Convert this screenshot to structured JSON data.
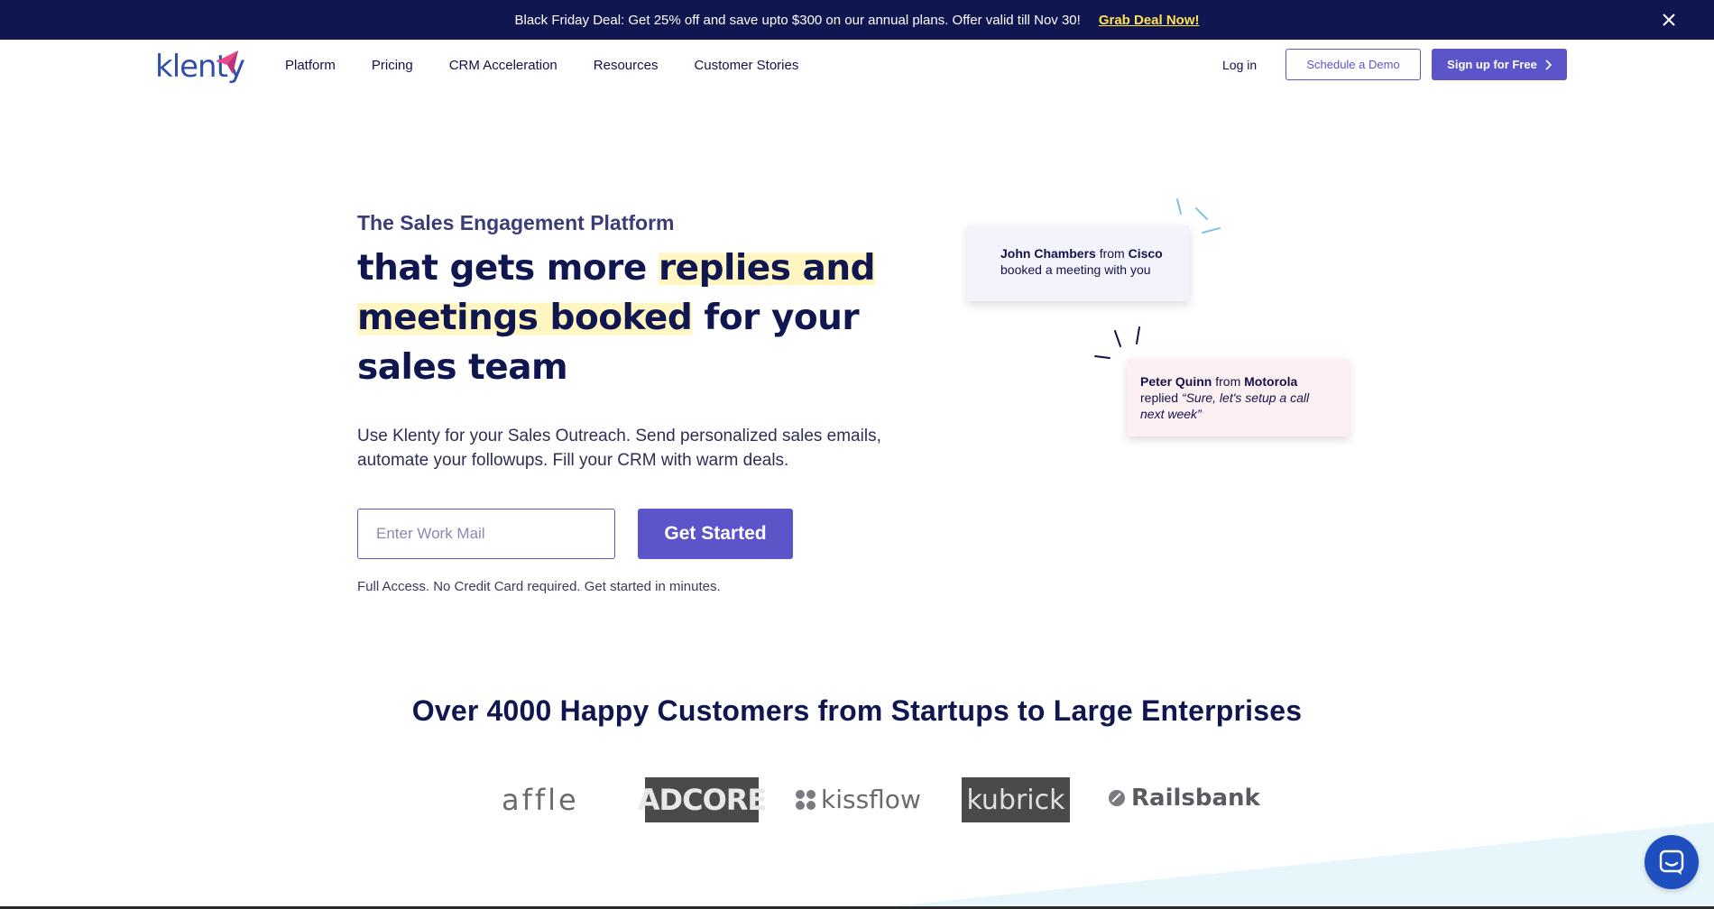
{
  "promo": {
    "message": "Black Friday Deal: Get 25% off and save upto $300 on our annual plans. Offer valid till Nov 30!",
    "link": "Grab Deal Now!"
  },
  "header": {
    "logo": "klenty",
    "nav": [
      "Platform",
      "Pricing",
      "CRM Acceleration",
      "Resources",
      "Customer Stories"
    ],
    "login": "Log in",
    "demo": "Schedule a Demo",
    "signup": "Sign up for Free"
  },
  "hero": {
    "eyebrow": "The Sales Engagement Platform",
    "headline_part1": "that gets more ",
    "headline_hl1": "replies and",
    "headline_hl2": "meetings booked",
    "headline_part2": " for your sales team",
    "subtext": "Use Klenty for your Sales Outreach. Send personalized sales emails, automate your followups. Fill your CRM with warm deals.",
    "email_placeholder": "Enter Work Mail",
    "cta": "Get Started",
    "fineprint": "Full Access. No Credit Card required. Get started in minutes."
  },
  "cards": {
    "card1": {
      "name": "John Chambers",
      "from": " from ",
      "company": "Cisco",
      "text": "booked a meeting with you"
    },
    "card2": {
      "name": "Peter Quinn",
      "from": " from ",
      "company": "Motorola",
      "replied": "replied ",
      "quote": "“Sure, let's setup a call next week”"
    }
  },
  "customers": {
    "title": "Over 4000 Happy Customers from Startups to Large Enterprises",
    "logos": {
      "affle": "affle",
      "adcore": "ADCORE",
      "kissflow": "kissflow",
      "kubrick": "kubrick",
      "railsbank": "Railsbank"
    }
  },
  "colors": {
    "navy": "#0f1650",
    "accent": "#5b55c9",
    "highlight": "#fff6c2",
    "deal": "#ffe24a"
  },
  "icons": [
    "close-icon",
    "chevron-right-icon",
    "chat-icon",
    "klenty-logo-icon"
  ]
}
